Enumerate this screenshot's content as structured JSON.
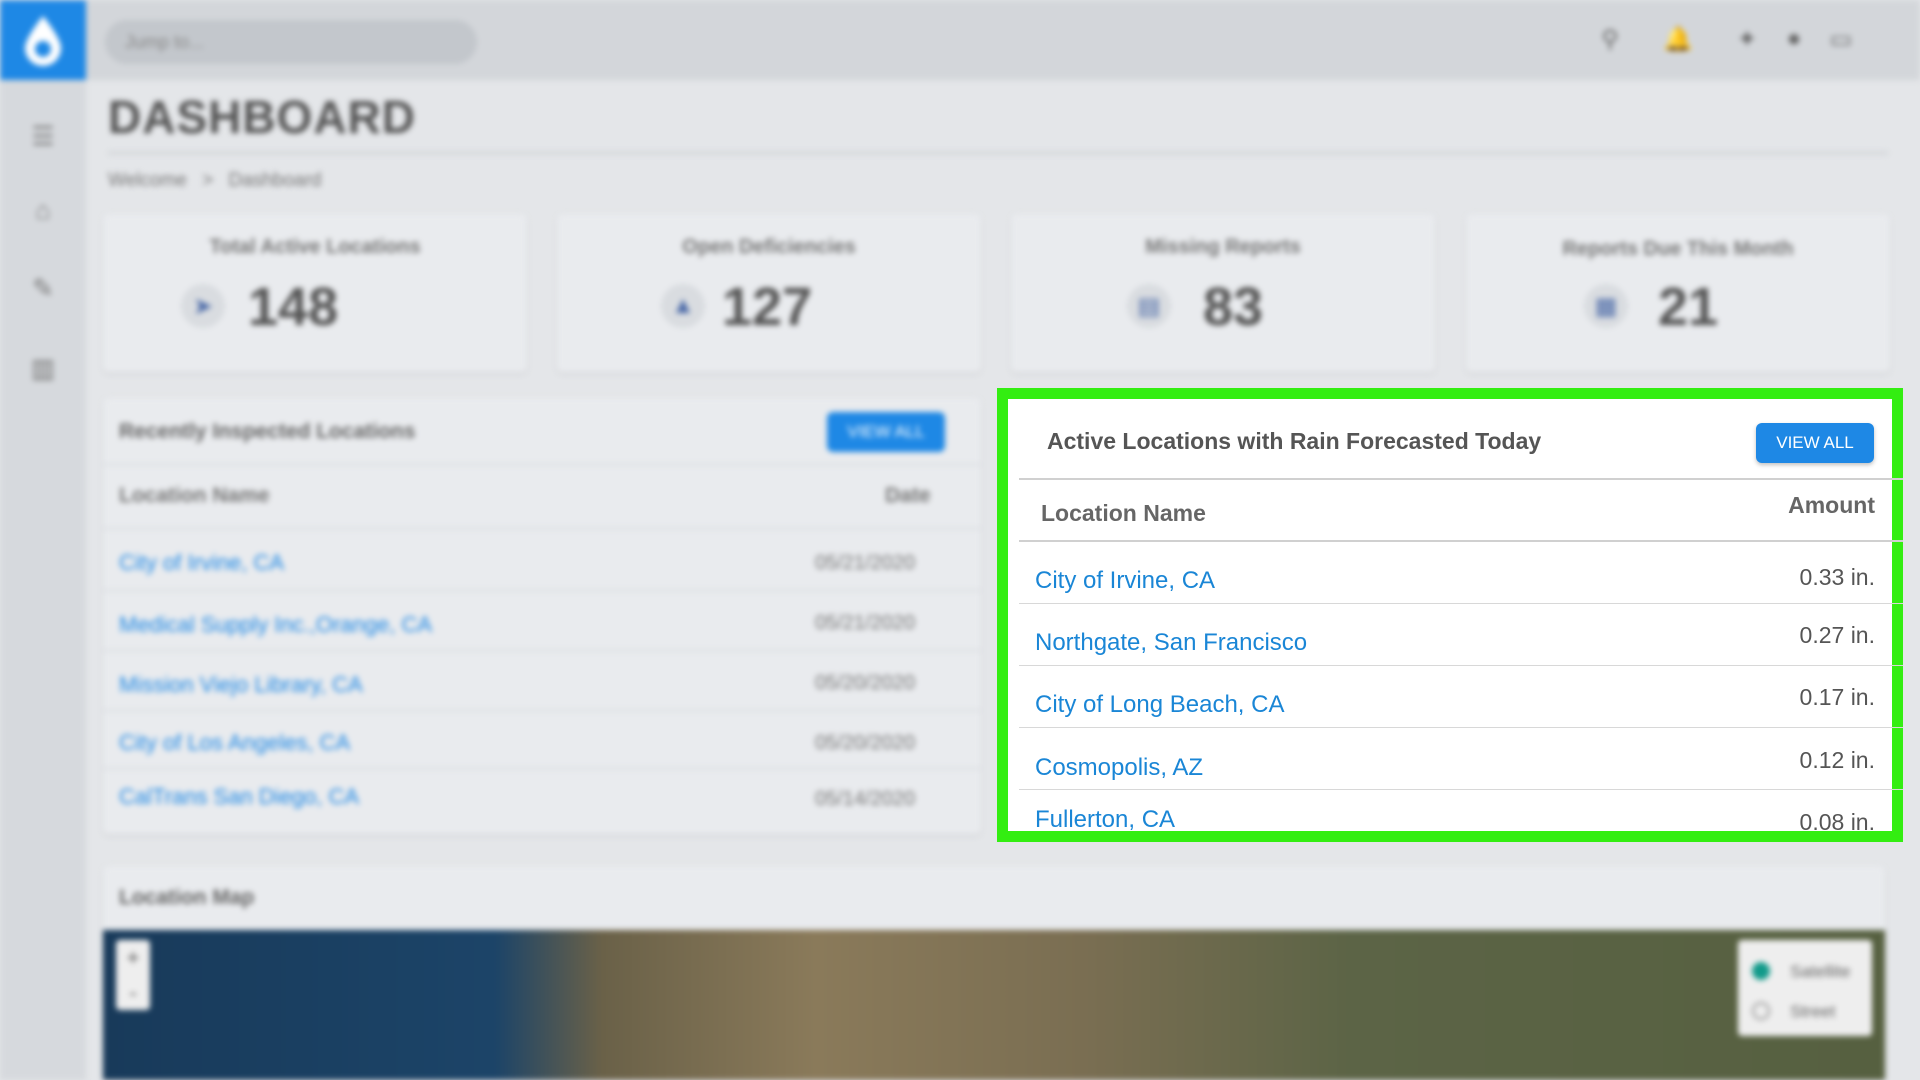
{
  "topbar": {
    "search_placeholder": "Jump to..."
  },
  "page": {
    "title": "DASHBOARD",
    "breadcrumb": [
      "Welcome",
      ">",
      "Dashboard"
    ]
  },
  "stats": [
    {
      "label": "Total Active Locations",
      "value": "148",
      "icon": "send-icon"
    },
    {
      "label": "Open Deficiencies",
      "value": "127",
      "icon": "warning-icon"
    },
    {
      "label": "Missing Reports",
      "value": "83",
      "icon": "document-icon"
    },
    {
      "label": "Reports Due This Month",
      "value": "21",
      "icon": "calendar-icon"
    }
  ],
  "recent": {
    "title": "Recently Inspected Locations",
    "view_all": "VIEW ALL",
    "columns": [
      "Location Name",
      "Date"
    ],
    "rows": [
      {
        "name": "City of Irvine, CA",
        "date": "05/21/2020"
      },
      {
        "name": "Medical Supply Inc.,Orange, CA",
        "date": "05/21/2020"
      },
      {
        "name": "Mission Viejo Library, CA",
        "date": "05/20/2020"
      },
      {
        "name": "City of Los Angeles, CA",
        "date": "05/20/2020"
      },
      {
        "name": "CalTrans San Diego, CA",
        "date": "05/14/2020"
      }
    ]
  },
  "rain": {
    "title": "Active Locations with Rain Forecasted Today",
    "view_all": "VIEW ALL",
    "columns": [
      "Location Name",
      "Amount"
    ],
    "rows": [
      {
        "name": "City of Irvine, CA",
        "amount": "0.33 in."
      },
      {
        "name": "Northgate, San Francisco",
        "amount": "0.27 in."
      },
      {
        "name": "City of Long Beach, CA",
        "amount": "0.17 in."
      },
      {
        "name": "Cosmopolis, AZ",
        "amount": "0.12 in."
      },
      {
        "name": "Fullerton, CA",
        "amount": "0.08 in."
      }
    ]
  },
  "map": {
    "title": "Location Map",
    "zoom_in": "+",
    "zoom_out": "-",
    "layers": [
      "Satellite",
      "Street"
    ]
  },
  "colors": {
    "accent": "#1e88e5",
    "highlight": "#33ee11"
  }
}
